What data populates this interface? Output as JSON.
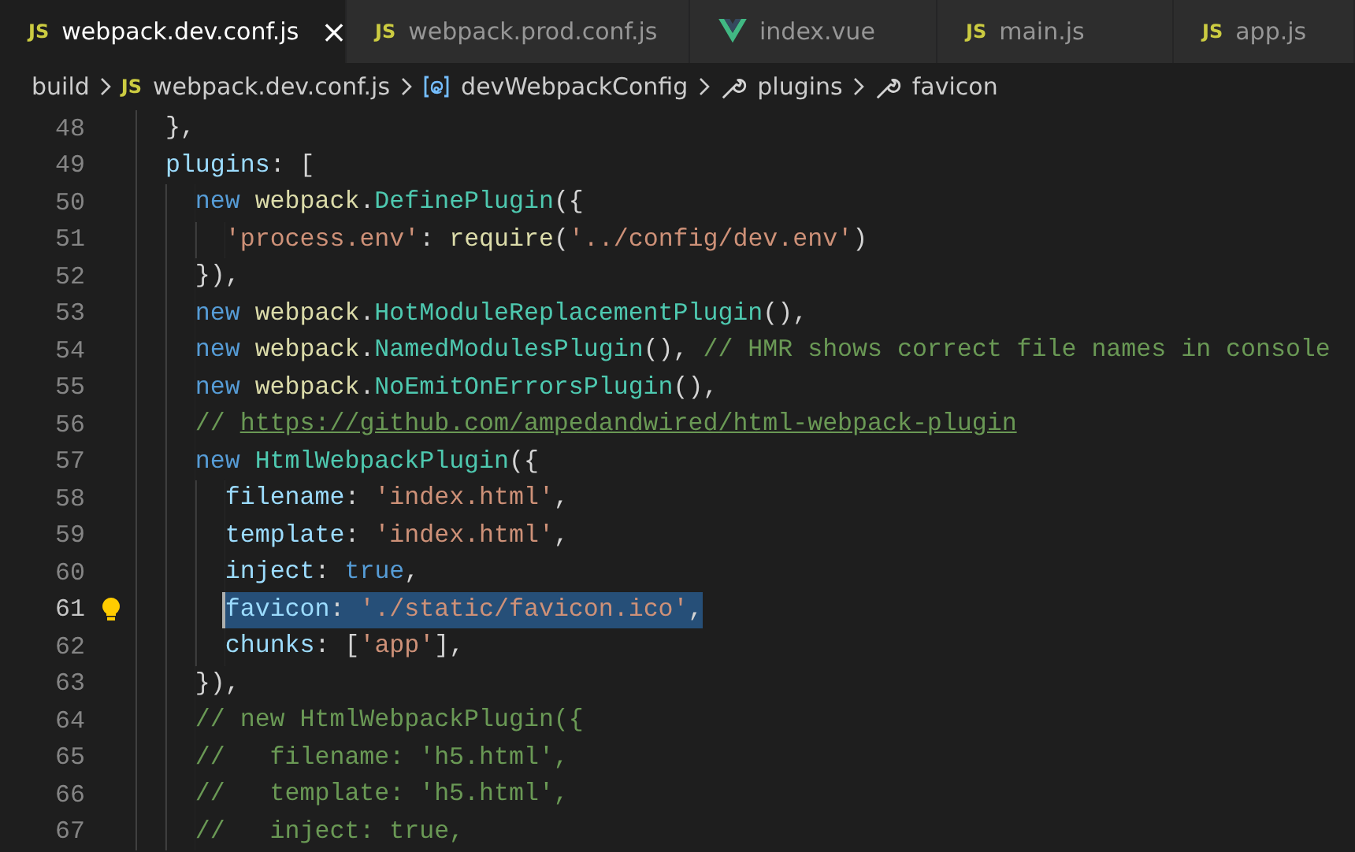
{
  "tabs": [
    {
      "kind": "js",
      "badge": "JS",
      "label": "webpack.dev.conf.js",
      "selected": true,
      "close": "×"
    },
    {
      "kind": "js",
      "badge": "JS",
      "label": "webpack.prod.conf.js",
      "selected": false
    },
    {
      "kind": "vue",
      "label": "index.vue",
      "selected": false
    },
    {
      "kind": "js",
      "badge": "JS",
      "label": "main.js",
      "selected": false
    },
    {
      "kind": "js",
      "badge": "JS",
      "label": "app.js",
      "selected": false
    }
  ],
  "breadcrumbs": [
    {
      "kind": "folder",
      "text": "build"
    },
    {
      "kind": "js",
      "badge": "JS",
      "text": "webpack.dev.conf.js"
    },
    {
      "kind": "object",
      "text": "devWebpackConfig"
    },
    {
      "kind": "property",
      "text": "plugins"
    },
    {
      "kind": "property",
      "text": "favicon"
    }
  ],
  "lines": [
    {
      "number": "48",
      "selected": false,
      "lightbulb": false,
      "tokens": [
        {
          "kind": "punct",
          "text": "},"
        }
      ]
    },
    {
      "number": "49",
      "selected": false,
      "lightbulb": false,
      "tokens": [
        {
          "kind": "prop",
          "text": "plugins"
        },
        {
          "kind": "punct",
          "text": ": ["
        }
      ],
      "children": [
        {
          "number": "50",
          "selected": false,
          "lightbulb": false,
          "tokens": [
            {
              "kind": "keyword",
              "text": "new "
            },
            {
              "kind": "func",
              "text": "webpack"
            },
            {
              "kind": "punct",
              "text": "."
            },
            {
              "kind": "class",
              "text": "DefinePlugin"
            },
            {
              "kind": "punct",
              "text": "({"
            }
          ],
          "children": [
            {
              "number": "51",
              "selected": false,
              "lightbulb": false,
              "tokens": [
                {
                  "kind": "string",
                  "text": "'process.env'"
                },
                {
                  "kind": "punct",
                  "text": ": "
                },
                {
                  "kind": "func",
                  "text": "require"
                },
                {
                  "kind": "punct",
                  "text": "("
                },
                {
                  "kind": "string",
                  "text": "'../config/dev.env'"
                },
                {
                  "kind": "punct",
                  "text": ")"
                }
              ]
            }
          ]
        },
        {
          "number": "52",
          "selected": false,
          "lightbulb": false,
          "tokens": [
            {
              "kind": "punct",
              "text": "}),"
            }
          ]
        },
        {
          "number": "53",
          "selected": false,
          "lightbulb": false,
          "tokens": [
            {
              "kind": "keyword",
              "text": "new "
            },
            {
              "kind": "func",
              "text": "webpack"
            },
            {
              "kind": "punct",
              "text": "."
            },
            {
              "kind": "class",
              "text": "HotModuleReplacementPlugin"
            },
            {
              "kind": "punct",
              "text": "(),"
            }
          ]
        },
        {
          "number": "54",
          "selected": false,
          "lightbulb": false,
          "tokens": [
            {
              "kind": "keyword",
              "text": "new "
            },
            {
              "kind": "func",
              "text": "webpack"
            },
            {
              "kind": "punct",
              "text": "."
            },
            {
              "kind": "class",
              "text": "NamedModulesPlugin"
            },
            {
              "kind": "punct",
              "text": "(), "
            },
            {
              "kind": "comment",
              "text": "// HMR shows correct file names in console"
            }
          ]
        },
        {
          "number": "55",
          "selected": false,
          "lightbulb": false,
          "tokens": [
            {
              "kind": "keyword",
              "text": "new "
            },
            {
              "kind": "func",
              "text": "webpack"
            },
            {
              "kind": "punct",
              "text": "."
            },
            {
              "kind": "class",
              "text": "NoEmitOnErrorsPlugin"
            },
            {
              "kind": "punct",
              "text": "(),"
            }
          ]
        },
        {
          "number": "56",
          "selected": false,
          "lightbulb": false,
          "tokens": [
            {
              "kind": "comment",
              "text": "// "
            },
            {
              "kind": "link",
              "text": "https://github.com/ampedandwired/html-webpack-plugin"
            }
          ]
        },
        {
          "number": "57",
          "selected": false,
          "lightbulb": false,
          "tokens": [
            {
              "kind": "keyword",
              "text": "new "
            },
            {
              "kind": "class",
              "text": "HtmlWebpackPlugin"
            },
            {
              "kind": "punct",
              "text": "({"
            }
          ],
          "children": [
            {
              "number": "58",
              "selected": false,
              "lightbulb": false,
              "tokens": [
                {
                  "kind": "prop",
                  "text": "filename"
                },
                {
                  "kind": "punct",
                  "text": ": "
                },
                {
                  "kind": "string",
                  "text": "'index.html'"
                },
                {
                  "kind": "punct",
                  "text": ","
                }
              ]
            },
            {
              "number": "59",
              "selected": false,
              "lightbulb": false,
              "tokens": [
                {
                  "kind": "prop",
                  "text": "template"
                },
                {
                  "kind": "punct",
                  "text": ": "
                },
                {
                  "kind": "string",
                  "text": "'index.html'"
                },
                {
                  "kind": "punct",
                  "text": ","
                }
              ]
            },
            {
              "number": "60",
              "selected": false,
              "lightbulb": false,
              "tokens": [
                {
                  "kind": "prop",
                  "text": "inject"
                },
                {
                  "kind": "punct",
                  "text": ": "
                },
                {
                  "kind": "keyword",
                  "text": "true"
                },
                {
                  "kind": "punct",
                  "text": ","
                }
              ]
            },
            {
              "number": "61",
              "selected": true,
              "lightbulb": true,
              "tokens": [
                {
                  "kind": "prop",
                  "text": "favicon"
                },
                {
                  "kind": "punct",
                  "text": ": "
                },
                {
                  "kind": "string",
                  "text": "'./static/favicon.ico'"
                },
                {
                  "kind": "punct",
                  "text": ","
                }
              ]
            },
            {
              "number": "62",
              "selected": false,
              "lightbulb": false,
              "tokens": [
                {
                  "kind": "prop",
                  "text": "chunks"
                },
                {
                  "kind": "punct",
                  "text": ": ["
                },
                {
                  "kind": "string",
                  "text": "'app'"
                },
                {
                  "kind": "punct",
                  "text": "],"
                }
              ]
            }
          ]
        },
        {
          "number": "63",
          "selected": false,
          "lightbulb": false,
          "tokens": [
            {
              "kind": "punct",
              "text": "}),"
            }
          ]
        },
        {
          "number": "64",
          "selected": false,
          "lightbulb": false,
          "tokens": [
            {
              "kind": "comment",
              "text": "// new HtmlWebpackPlugin({"
            }
          ]
        },
        {
          "number": "65",
          "selected": false,
          "lightbulb": false,
          "tokens": [
            {
              "kind": "comment",
              "text": "//   filename: 'h5.html',"
            }
          ]
        },
        {
          "number": "66",
          "selected": false,
          "lightbulb": false,
          "tokens": [
            {
              "kind": "comment",
              "text": "//   template: 'h5.html',"
            }
          ]
        },
        {
          "number": "67",
          "selected": false,
          "lightbulb": false,
          "tokens": [
            {
              "kind": "comment",
              "text": "//   inject: true,"
            }
          ]
        }
      ]
    }
  ]
}
